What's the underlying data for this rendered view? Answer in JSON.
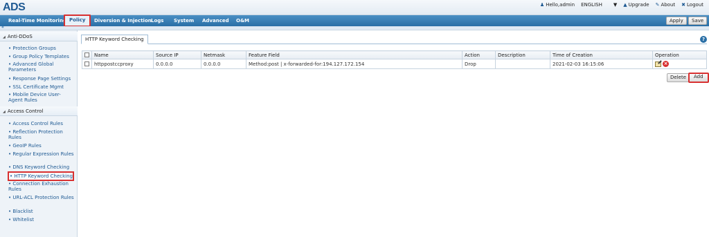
{
  "app": {
    "logo": "ADS"
  },
  "user_bar": {
    "user": "Hello,admin",
    "language": "ENGLISH",
    "upgrade": "Upgrade",
    "about": "About",
    "logout": "Logout"
  },
  "nav": {
    "items": [
      "Real-Time Monitoring",
      "Policy",
      "Diversion & Injection",
      "Logs",
      "System",
      "Advanced",
      "O&M"
    ],
    "apply": "Apply",
    "save": "Save"
  },
  "sidebar": {
    "sections": [
      {
        "title": "Anti-DDoS",
        "items": [
          "Protection Groups",
          "Group Policy Templates",
          "Advanced Global Parameters",
          "Response Page Settings",
          "SSL Certificate Mgmt",
          "Mobile Device User-Agent Rules"
        ]
      },
      {
        "title": "Access Control",
        "items": [
          "Access Control Rules",
          "Reflection Protection Rules",
          "GeoIP Rules",
          "Regular Expression Rules",
          "DNS Keyword Checking",
          "HTTP Keyword Checking",
          "Connection Exhaustion Rules",
          "URL-ACL Protection Rules",
          "Blacklist",
          "Whitelist"
        ]
      }
    ]
  },
  "main": {
    "tab": "HTTP Keyword Checking",
    "table": {
      "headers": [
        "Name",
        "Source IP",
        "Netmask",
        "Feature Field",
        "Action",
        "Description",
        "Time of Creation",
        "Operation"
      ],
      "rows": [
        [
          "httppostccproxy",
          "0.0.0.0",
          "0.0.0.0",
          "Method:post | x-forwarded-for:194.127.172.154",
          "Drop",
          "",
          "2021-02-03 16:15:06"
        ]
      ]
    },
    "delete": "Delete",
    "add": "Add"
  },
  "colors": {
    "brand": "#1f5a93",
    "nav": "#2a6fa6",
    "highlight": "#d83030"
  }
}
